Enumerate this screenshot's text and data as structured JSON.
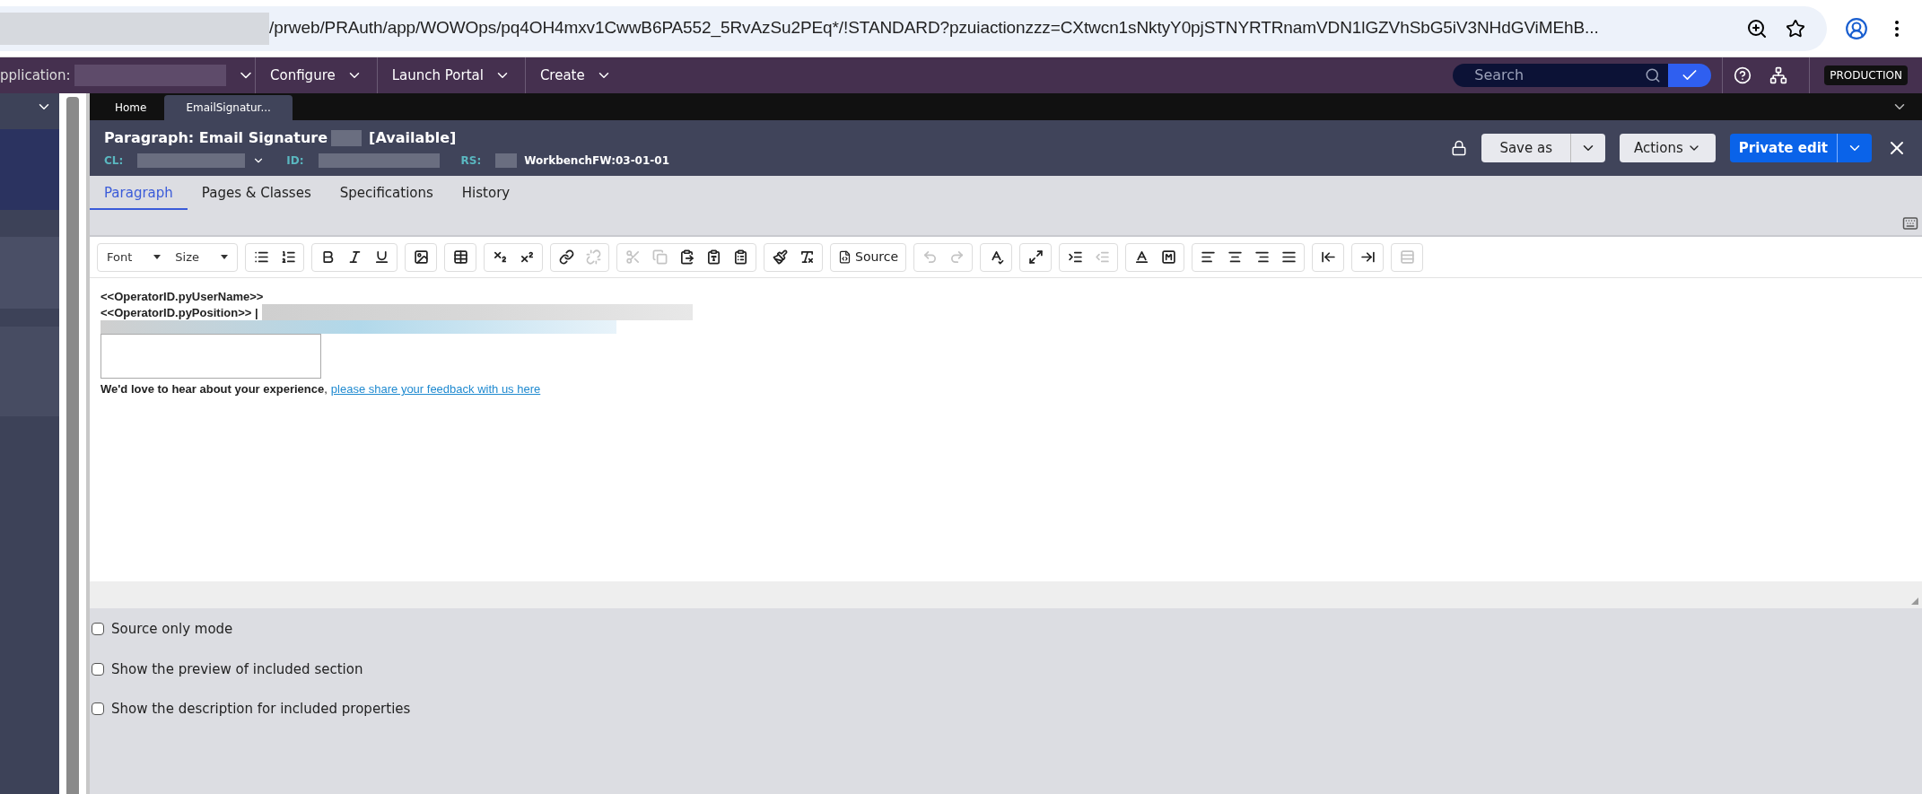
{
  "browser": {
    "url": "/prweb/PRAuth/app/WOWOps/pq4OH4mxv1CwwB6PA552_5RvAzSu2PEq*/!STANDARD?pzuiactionzzz=CXtwcn1sNktyY0pjSTNYRTRnamVDN1lGZVhSbG5iV3NHdGViMEhB..."
  },
  "app_bar": {
    "application_label": "pplication:",
    "menus": [
      "Configure",
      "Launch Portal",
      "Create"
    ],
    "search": {
      "placeholder": "Search"
    },
    "environment": "PRODUCTION"
  },
  "doc_tabs": [
    {
      "label": "Home",
      "selected": false
    },
    {
      "label": "EmailSignatur...",
      "selected": true
    }
  ],
  "header": {
    "title": "Paragraph: Email Signature",
    "status": "[Available]",
    "cl_label": "CL:",
    "id_label": "ID:",
    "rs_label": "RS:",
    "ruleset": "WorkbenchFW:03-01-01",
    "buttons": {
      "save_as": "Save as",
      "actions": "Actions",
      "private_edit": "Private edit"
    }
  },
  "tabs": [
    {
      "label": "Paragraph",
      "selected": true
    },
    {
      "label": "Pages & Classes",
      "selected": false
    },
    {
      "label": "Specifications",
      "selected": false
    },
    {
      "label": "History",
      "selected": false
    }
  ],
  "toolbar": [
    [
      {
        "kind": "dropdown",
        "label": "Font"
      },
      {
        "kind": "dropdown",
        "label": "Size"
      }
    ],
    [
      {
        "kind": "bullets",
        "disabled": false
      },
      {
        "kind": "numbering",
        "disabled": false
      }
    ],
    [
      {
        "kind": "bold",
        "disabled": false
      },
      {
        "kind": "italic",
        "disabled": false
      },
      {
        "kind": "underline",
        "disabled": false
      }
    ],
    [
      {
        "kind": "image",
        "disabled": false
      }
    ],
    [
      {
        "kind": "table",
        "disabled": false
      }
    ],
    [
      {
        "kind": "subscript",
        "disabled": false
      },
      {
        "kind": "superscript",
        "disabled": false
      }
    ],
    [
      {
        "kind": "link",
        "disabled": false
      },
      {
        "kind": "unlink",
        "disabled": true
      }
    ],
    [
      {
        "kind": "cut",
        "disabled": true
      },
      {
        "kind": "copy",
        "disabled": true
      },
      {
        "kind": "paste",
        "disabled": false
      },
      {
        "kind": "pastetext",
        "disabled": false
      },
      {
        "kind": "pasteword",
        "disabled": false
      }
    ],
    [
      {
        "kind": "format",
        "disabled": false
      },
      {
        "kind": "clear",
        "disabled": false
      }
    ],
    [
      {
        "kind": "source",
        "label": "Source",
        "disabled": false
      }
    ],
    [
      {
        "kind": "undo",
        "disabled": true
      },
      {
        "kind": "redo",
        "disabled": true
      }
    ],
    [
      {
        "kind": "spell",
        "disabled": false
      }
    ],
    [
      {
        "kind": "maximize",
        "disabled": false
      }
    ],
    [
      {
        "kind": "indent",
        "disabled": false
      },
      {
        "kind": "outdent",
        "disabled": true
      }
    ],
    [
      {
        "kind": "textcolor",
        "disabled": false
      },
      {
        "kind": "bgcolor",
        "disabled": false
      }
    ],
    [
      {
        "kind": "alignleft",
        "disabled": false
      },
      {
        "kind": "aligncenter",
        "disabled": false
      },
      {
        "kind": "alignright",
        "disabled": false
      },
      {
        "kind": "justify",
        "disabled": false
      }
    ],
    [
      {
        "kind": "insertbefore",
        "disabled": false
      }
    ],
    [
      {
        "kind": "insertafter",
        "disabled": false
      }
    ],
    [
      {
        "kind": "blocks",
        "disabled": true
      }
    ]
  ],
  "editor": {
    "line_1": "<<OperatorID.pyUserName>>",
    "line_2": "<<OperatorID.pyPosition>> |",
    "feedback_text": "We'd love to hear about your experience",
    "feedback_separator": ",",
    "feedback_link": "please share your feedback with us here"
  },
  "options": [
    {
      "label": "Source only mode",
      "checked": false
    },
    {
      "label": "Show the preview of included section",
      "checked": false
    },
    {
      "label": "Show the description for included properties",
      "checked": false
    }
  ]
}
